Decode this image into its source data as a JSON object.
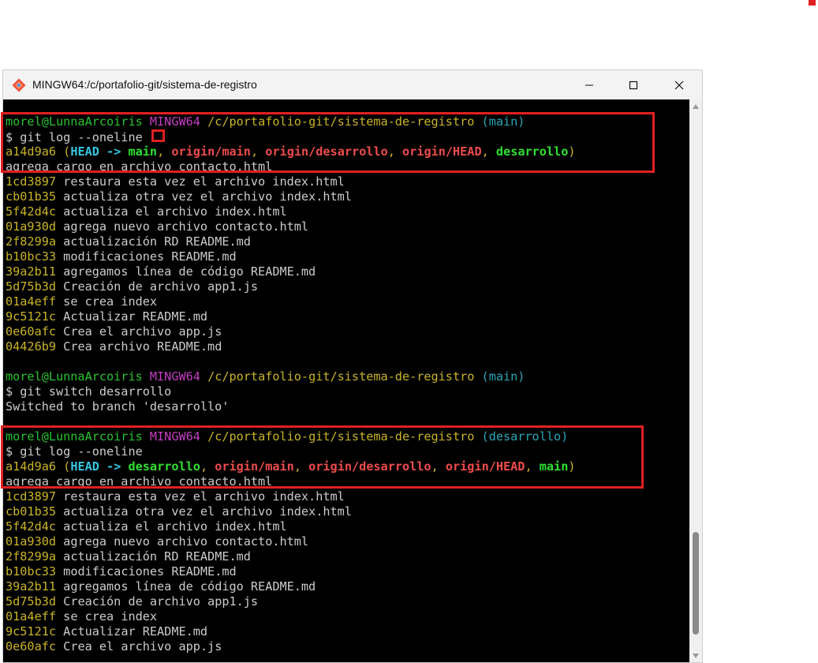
{
  "window": {
    "title": "MINGW64:/c/portafolio-git/sistema-de-registro",
    "app_icon": "git-bash-icon",
    "controls": [
      "minimize-icon",
      "maximize-icon",
      "close-icon"
    ]
  },
  "colors": {
    "user": "#27c42e",
    "mingw": "#c53ec3",
    "path": "#c9b427",
    "branch": "#2aa7b7",
    "hash": "#c9b427",
    "head": "#36c5e0",
    "local_branch": "#2fe02f",
    "remote_branch": "#ee4c4c",
    "highlight": "#e02020"
  },
  "terminal": {
    "session1": {
      "prompt": {
        "user": "morel@LunnaArcoiris",
        "mingw": "MINGW64",
        "path": "/c/portafolio-git/sistema-de-registro",
        "branch": "(main)"
      },
      "command": "$ git log --oneline",
      "head_commit": {
        "hash": "a14d9a6",
        "head": "HEAD ->",
        "refs": [
          {
            "name": "main",
            "kind": "local"
          },
          {
            "name": "origin/main",
            "kind": "remote"
          },
          {
            "name": "origin/desarrollo",
            "kind": "remote"
          },
          {
            "name": "origin/HEAD",
            "kind": "remote"
          },
          {
            "name": "desarrollo",
            "kind": "local"
          }
        ]
      },
      "head_message": "agrega cargo en archivo contacto.html",
      "commits": [
        {
          "hash": "1cd3897",
          "message": "restaura esta vez el archivo index.html"
        },
        {
          "hash": "cb01b35",
          "message": "actualiza otra vez el archivo index.html"
        },
        {
          "hash": "5f42d4c",
          "message": "actualiza el archivo index.html"
        },
        {
          "hash": "01a930d",
          "message": "agrega nuevo archivo contacto.html"
        },
        {
          "hash": "2f8299a",
          "message": "actualización RD README.md"
        },
        {
          "hash": "b10bc33",
          "message": "modificaciones README.md"
        },
        {
          "hash": "39a2b11",
          "message": "agregamos línea de código README.md"
        },
        {
          "hash": "5d75b3d",
          "message": "Creación de archivo app1.js"
        },
        {
          "hash": "01a4eff",
          "message": "se crea index"
        },
        {
          "hash": "9c5121c",
          "message": "Actualizar README.md"
        },
        {
          "hash": "0e60afc",
          "message": "Crea el archivo app.js"
        },
        {
          "hash": "04426b9",
          "message": "Crea archivo README.md"
        }
      ]
    },
    "session2": {
      "prompt": {
        "user": "morel@LunnaArcoiris",
        "mingw": "MINGW64",
        "path": "/c/portafolio-git/sistema-de-registro",
        "branch": "(main)"
      },
      "command": "$ git switch desarrollo",
      "output": "Switched to branch 'desarrollo'"
    },
    "session3": {
      "prompt": {
        "user": "morel@LunnaArcoiris",
        "mingw": "MINGW64",
        "path": "/c/portafolio-git/sistema-de-registro",
        "branch": "(desarrollo)"
      },
      "command": "$ git log --oneline",
      "head_commit": {
        "hash": "a14d9a6",
        "head": "HEAD ->",
        "refs": [
          {
            "name": "desarrollo",
            "kind": "local"
          },
          {
            "name": "origin/main",
            "kind": "remote"
          },
          {
            "name": "origin/desarrollo",
            "kind": "remote"
          },
          {
            "name": "origin/HEAD",
            "kind": "remote"
          },
          {
            "name": "main",
            "kind": "local"
          }
        ]
      },
      "head_message": "agrega cargo en archivo contacto.html",
      "commits": [
        {
          "hash": "1cd3897",
          "message": "restaura esta vez el archivo index.html"
        },
        {
          "hash": "cb01b35",
          "message": "actualiza otra vez el archivo index.html"
        },
        {
          "hash": "5f42d4c",
          "message": "actualiza el archivo index.html"
        },
        {
          "hash": "01a930d",
          "message": "agrega nuevo archivo contacto.html"
        },
        {
          "hash": "2f8299a",
          "message": "actualización RD README.md"
        },
        {
          "hash": "b10bc33",
          "message": "modificaciones README.md"
        },
        {
          "hash": "39a2b11",
          "message": "agregamos línea de código README.md"
        },
        {
          "hash": "5d75b3d",
          "message": "Creación de archivo app1.js"
        },
        {
          "hash": "01a4eff",
          "message": "se crea index"
        },
        {
          "hash": "9c5121c",
          "message": "Actualizar README.md"
        },
        {
          "hash": "0e60afc",
          "message": "Crea el archivo app.js"
        }
      ]
    }
  }
}
